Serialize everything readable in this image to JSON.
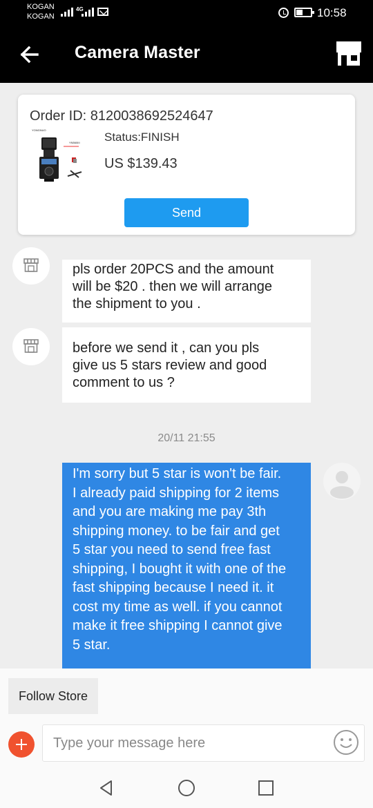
{
  "status_bar": {
    "carrier_1": "KOGAN",
    "carrier_2": "KOGAN",
    "network": "4G",
    "time": "10:58"
  },
  "header": {
    "title": "Camera Master",
    "back_icon": "arrow-left-icon",
    "store_icon": "store-icon"
  },
  "order": {
    "id_label": "Order ID: 8120038692524647",
    "status": "Status:FINISH",
    "price": "US $139.43",
    "send_label": "Send",
    "thumb_brand": "YONGNUO",
    "thumb_model": "YN560III"
  },
  "messages": [
    {
      "sender": "store",
      "text": "pls order 20PCS  and the amount\nwill be $20 . then we will arrange\nthe shipment to you ."
    },
    {
      "sender": "store",
      "text": "before we send it , can you pls\ngive us 5 stars review and good\ncomment to us ?"
    },
    {
      "sender": "me",
      "text": "I'm sorry but 5 star is won't be fair.\nI already paid shipping for 2 items\nand you are making me pay 3th\nshipping money. to be fair and get\n5 star you need to send free fast\nshipping, I bought it with one of the\nfast shipping because I need it. it\ncost my time as well. if you cannot\nmake it free shipping I cannot give\n5 star."
    }
  ],
  "timestamp": "20/11 21:55",
  "composer": {
    "follow_label": "Follow Store",
    "placeholder": "Type your message here"
  },
  "colors": {
    "accent": "#1e9bf0",
    "my_bubble": "#2f87e4",
    "plus_button": "#f0522f"
  }
}
